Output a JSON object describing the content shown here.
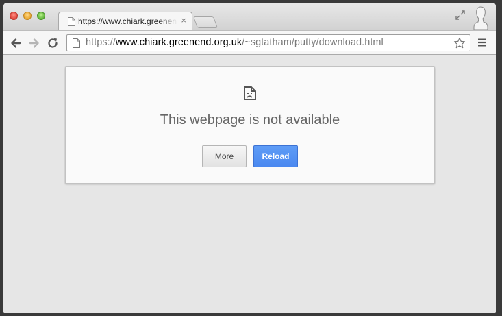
{
  "window": {
    "accent_color": "#4d8ff2"
  },
  "tab": {
    "title": "https://www.chiark.greenend.org.uk",
    "close_glyph": "×",
    "favicon": "page-icon"
  },
  "toolbar": {
    "back_icon": "arrow-left-icon",
    "forward_icon": "arrow-right-icon",
    "reload_icon": "reload-icon",
    "menu_icon": "hamburger-icon",
    "star_icon": "star-icon"
  },
  "omnibox": {
    "scheme": "https://",
    "host": "www.chiark.greenend.org.uk",
    "path": "/~sgtatham/putty/download.html"
  },
  "error": {
    "icon": "sad-page-icon",
    "title": "This webpage is not available",
    "more_label": "More",
    "reload_label": "Reload"
  }
}
